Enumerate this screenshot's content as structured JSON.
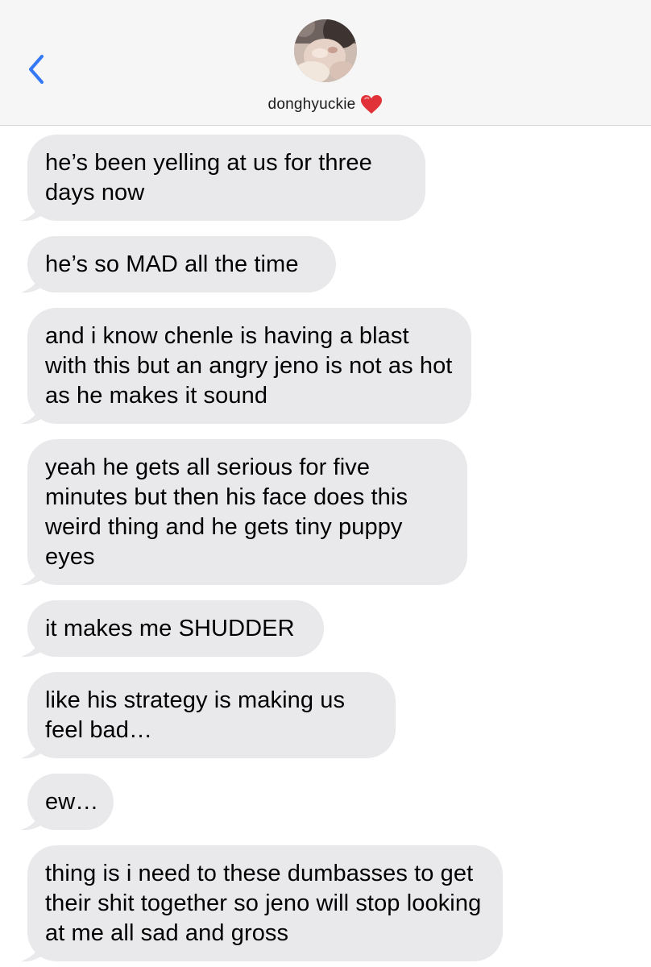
{
  "header": {
    "contact_name": "donghyuckie",
    "back_icon": "chevron-left-icon",
    "heart_icon": "red-heart-icon",
    "accent_color": "#3478f6",
    "heart_color": "#e1323a"
  },
  "messages": [
    {
      "text": "he’s been yelling at us for three days now"
    },
    {
      "text": "he’s so MAD all the time"
    },
    {
      "text": "and i know chenle is having a blast with this but an angry jeno is not as hot as he makes it sound"
    },
    {
      "text": "yeah he gets all serious for five minutes but then his face does this weird thing and he gets tiny puppy eyes"
    },
    {
      "text": "it makes me SHUDDER"
    },
    {
      "text": "like his strategy is making us feel bad…"
    },
    {
      "text": "ew…"
    },
    {
      "text": "thing is i need to these dumbasses to get their shit together so jeno will stop looking at me all sad and gross"
    }
  ],
  "bubble_color": "#e9e9eb"
}
